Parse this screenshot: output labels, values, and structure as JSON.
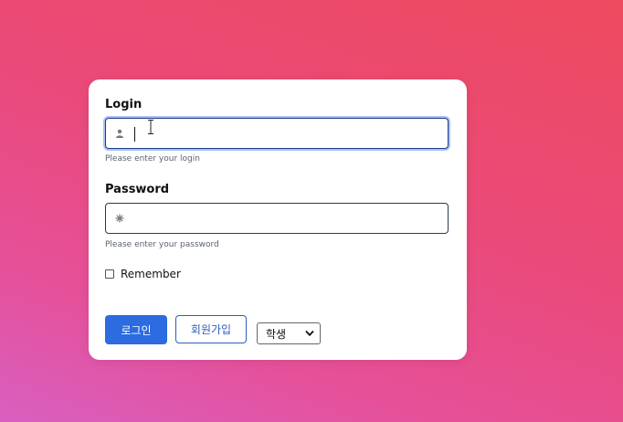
{
  "login": {
    "label": "Login",
    "value": "",
    "hint": "Please enter your login",
    "icon": "user-icon"
  },
  "password": {
    "label": "Password",
    "value": "",
    "hint": "Please enter your password",
    "icon": "asterisk-icon"
  },
  "remember": {
    "label": "Remember",
    "checked": false
  },
  "buttons": {
    "login": "로그인",
    "signup": "회원가입"
  },
  "role_select": {
    "selected": "학생"
  },
  "colors": {
    "primary": "#2c6be0",
    "outline": "#2c5fb8",
    "background_start": "#ee4a5f",
    "background_end": "#d85fc0"
  }
}
